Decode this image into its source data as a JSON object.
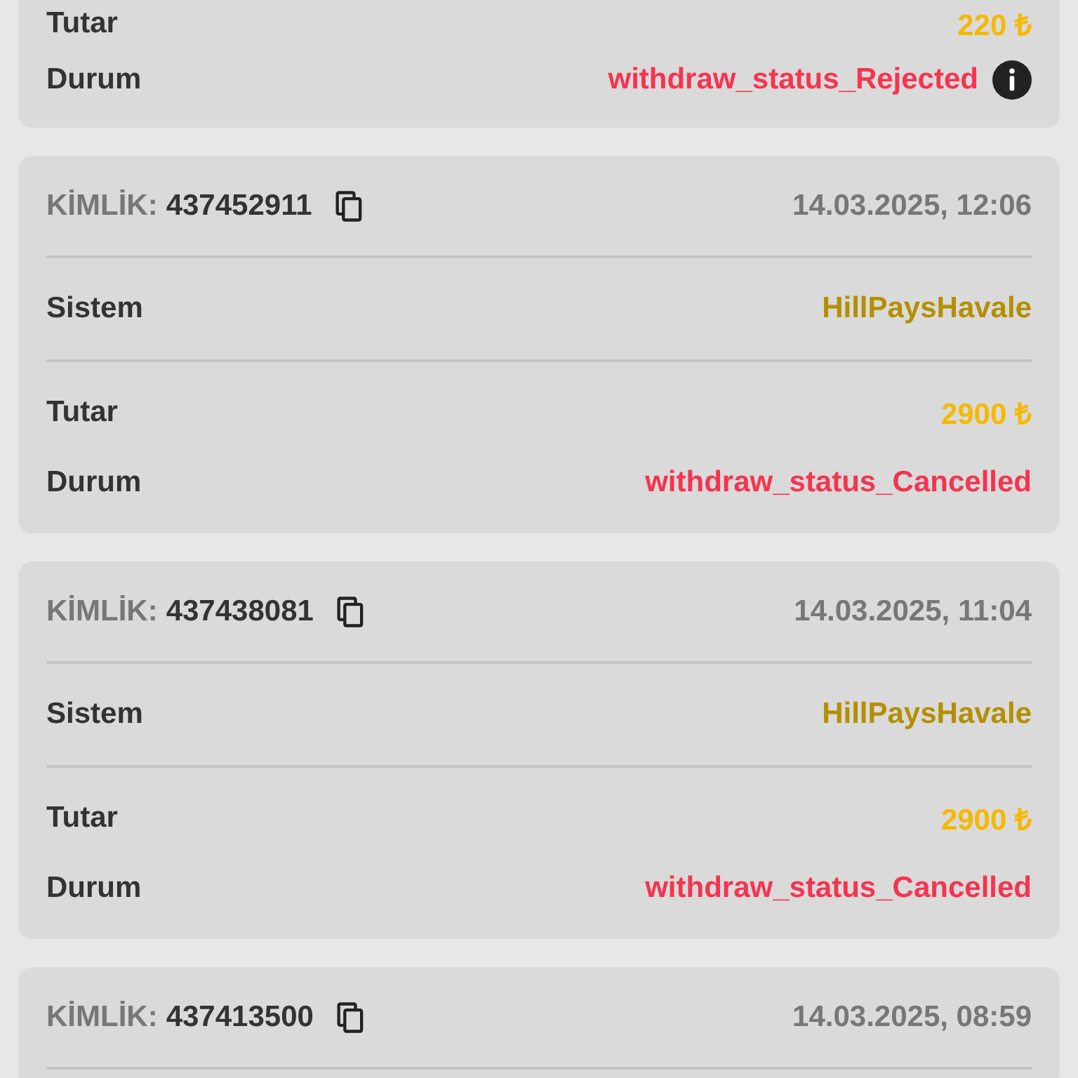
{
  "transactions": [
    {
      "rows": [
        {
          "kind": "amount",
          "label": "Tutar",
          "value": "220 ₺"
        },
        {
          "kind": "status",
          "label": "Durum",
          "value": "withdraw_status_Rejected",
          "info_icon": true
        }
      ]
    },
    {
      "id_label": "KİMLİK:",
      "id": "437452911",
      "date": "14.03.2025, 12:06",
      "rows": [
        {
          "kind": "system",
          "label": "Sistem",
          "value": "HillPaysHavale"
        },
        {
          "kind": "amount",
          "label": "Tutar",
          "value": "2900 ₺"
        },
        {
          "kind": "status",
          "label": "Durum",
          "value": "withdraw_status_Cancelled",
          "info_icon": false
        }
      ]
    },
    {
      "id_label": "KİMLİK:",
      "id": "437438081",
      "date": "14.03.2025, 11:04",
      "rows": [
        {
          "kind": "system",
          "label": "Sistem",
          "value": "HillPaysHavale"
        },
        {
          "kind": "amount",
          "label": "Tutar",
          "value": "2900 ₺"
        },
        {
          "kind": "status",
          "label": "Durum",
          "value": "withdraw_status_Cancelled",
          "info_icon": false
        }
      ]
    },
    {
      "id_label": "KİMLİK:",
      "id": "437413500",
      "date": "14.03.2025, 08:59"
    }
  ]
}
